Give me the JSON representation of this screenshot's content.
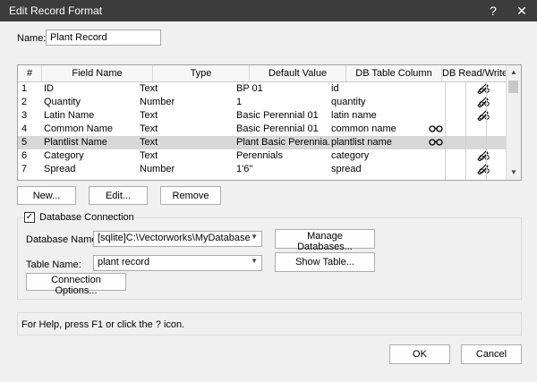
{
  "window": {
    "title": "Edit Record Format",
    "help_glyph": "?",
    "close_glyph": "✕"
  },
  "name_field": {
    "label": "Name:",
    "value": "Plant Record"
  },
  "table": {
    "columns": [
      "#",
      "Field Name",
      "Type",
      "Default Value",
      "DB Table Column",
      "DB Read/Write"
    ],
    "rows": [
      {
        "num": "1",
        "field": "ID",
        "type": "Text",
        "default": "BP 01",
        "column": "id",
        "rw_icon": "pencil-glasses-icon",
        "selected": false
      },
      {
        "num": "2",
        "field": "Quantity",
        "type": "Number",
        "default": "1",
        "column": "quantity",
        "rw_icon": "pencil-glasses-icon",
        "selected": false
      },
      {
        "num": "3",
        "field": "Latin Name",
        "type": "Text",
        "default": "Basic Perennial 01",
        "column": "latin name",
        "rw_icon": "pencil-glasses-icon",
        "selected": false
      },
      {
        "num": "4",
        "field": "Common Name",
        "type": "Text",
        "default": "Basic Perennial 01",
        "column": "common name",
        "rw_icon": "glasses-icon",
        "selected": false
      },
      {
        "num": "5",
        "field": "Plantlist Name",
        "type": "Text",
        "default": "Plant Basic Perennia...",
        "column": "plantlist name",
        "rw_icon": "glasses-icon",
        "selected": true
      },
      {
        "num": "6",
        "field": "Category",
        "type": "Text",
        "default": "Perennials",
        "column": "category",
        "rw_icon": "pencil-glasses-icon",
        "selected": false
      },
      {
        "num": "7",
        "field": "Spread",
        "type": "Number",
        "default": "1'6\"",
        "column": "spread",
        "rw_icon": "pencil-glasses-icon",
        "selected": false
      }
    ],
    "scroll_up": "▲",
    "scroll_down": "▼"
  },
  "buttons": {
    "new": "New...",
    "edit": "Edit...",
    "remove": "Remove",
    "manage_databases": "Manage Databases...",
    "show_table": "Show Table...",
    "connection_options": "Connection Options...",
    "ok": "OK",
    "cancel": "Cancel"
  },
  "database": {
    "checkbox_label": "Database Connection",
    "checked": true,
    "check_glyph": "✓",
    "name_label": "Database Name:",
    "name_value": "[sqlite]C:\\Vectorworks\\MyDatabase",
    "table_label": "Table Name:",
    "table_value": "plant record",
    "caret": "▼"
  },
  "help_text": "For Help, press F1 or click the ? icon."
}
